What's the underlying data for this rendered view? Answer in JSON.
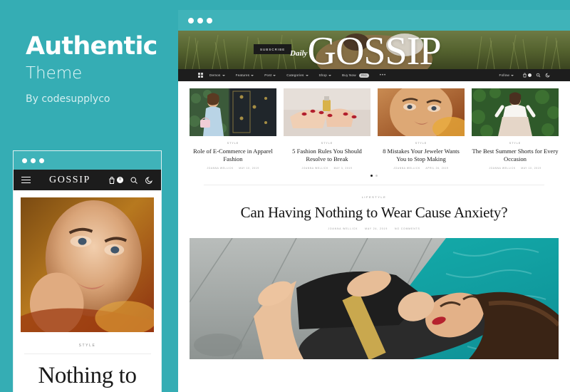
{
  "promo": {
    "title": "Authentic",
    "subtitle": "Theme",
    "byline": "By codesupplyco"
  },
  "colors": {
    "background_teal": "#35adb4",
    "chrome_teal": "#3fb3b9",
    "header_dark": "#1c1c1c",
    "nav_dark": "#1d1d1d",
    "text_dark": "#1a1a1a",
    "meta_gray": "#9b9b9b"
  },
  "mobile_mockup": {
    "chrome_dots": 3,
    "header": {
      "menu_icon": "hamburger-icon",
      "logo": "GOSSIP",
      "cart_icon": "shopping-bag-icon",
      "cart_count": "0",
      "search_icon": "search-icon",
      "darkmode_icon": "moon-icon"
    },
    "article": {
      "category": "STYLE",
      "title": "Nothing to"
    }
  },
  "desktop_mockup": {
    "chrome_dots": 3,
    "hero": {
      "subscribe_label": "SUBSCRIBE",
      "wordmark": "GOSSIP",
      "script_overlay": "Daily"
    },
    "nav": {
      "grid_icon": "grid-menu-icon",
      "items": [
        {
          "label": "Demos",
          "has_chevron": true
        },
        {
          "label": "Features",
          "has_chevron": true
        },
        {
          "label": "Post",
          "has_chevron": true
        },
        {
          "label": "Categories",
          "has_chevron": true
        },
        {
          "label": "Shop",
          "has_chevron": true
        },
        {
          "label": "Buy Now",
          "has_chevron": false,
          "badge": "PRO"
        }
      ],
      "more_label": "•••",
      "follow_label": "Follow",
      "cart_icon": "shopping-bag-icon",
      "cart_count": "0",
      "search_icon": "search-icon",
      "darkmode_icon": "moon-icon"
    },
    "cards": [
      {
        "category": "STYLE",
        "title": "Role of E-Commerce in Apparel Fashion",
        "author": "JOANNA WELLICK",
        "date": "MAY 10, 2019"
      },
      {
        "category": "STYLE",
        "title": "5 Fashion Rules You Should Resolve to Break",
        "author": "JOANNA WELLICK",
        "date": "MAY 3, 2019"
      },
      {
        "category": "STYLE",
        "title": "8 Mistakes Your Jeweler Wants You to Stop Making",
        "author": "JOANNA WELLICK",
        "date": "APRIL 26, 2019"
      },
      {
        "category": "STYLE",
        "title": "The Best Summer Shorts for Every Occasion",
        "author": "JOANNA WELLICK",
        "date": "MAY 10, 2019"
      }
    ],
    "pagination": {
      "total": 2,
      "active": 1
    },
    "feature": {
      "category": "LIFESTYLE",
      "title": "Can Having Nothing to Wear Cause Anxiety?",
      "author": "JOANNA WELLICK",
      "date": "MAY 24, 2019",
      "comments": "NO COMMENTS"
    }
  }
}
